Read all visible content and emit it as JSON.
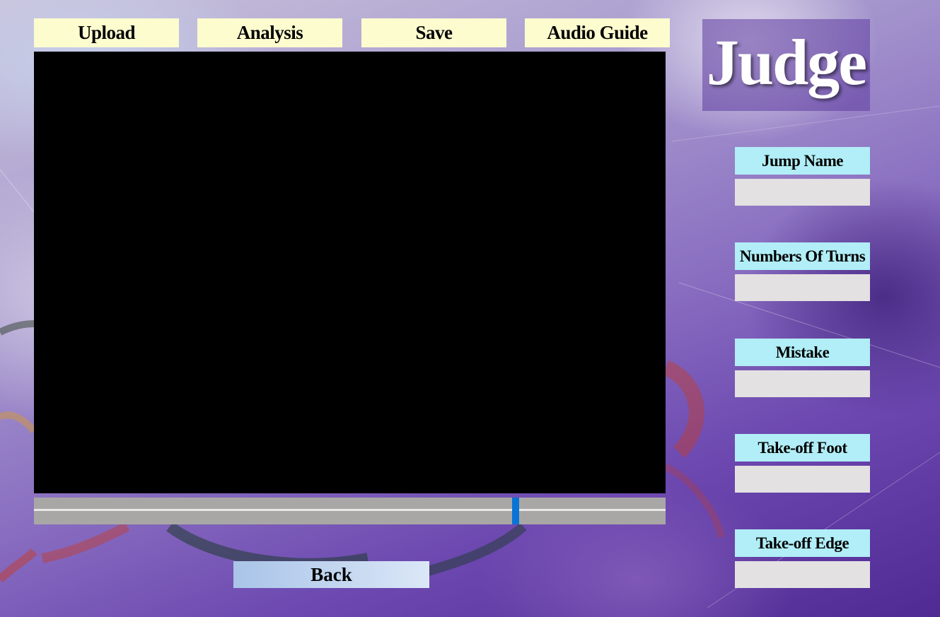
{
  "toolbar": {
    "upload_label": "Upload",
    "analysis_label": "Analysis",
    "save_label": "Save",
    "audio_guide_label": "Audio Guide"
  },
  "logo": {
    "text": "Judge"
  },
  "video": {
    "playback_position": 0.766
  },
  "fields": {
    "jump_name": {
      "label": "Jump Name",
      "value": ""
    },
    "number_of_turns": {
      "label": "Numbers Of Turns",
      "value": ""
    },
    "mistake": {
      "label": "Mistake",
      "value": ""
    },
    "takeoff_foot": {
      "label": "Take-off Foot",
      "value": ""
    },
    "takeoff_edge": {
      "label": "Take-off Edge",
      "value": ""
    }
  },
  "back_label": "Back",
  "colors": {
    "toolbar_button": "#fdfccf",
    "field_label": "#b1eef7",
    "field_input": "#e3e1e2",
    "timeline_thumb": "#0a74d6",
    "back_button": "#a9c4e8"
  }
}
